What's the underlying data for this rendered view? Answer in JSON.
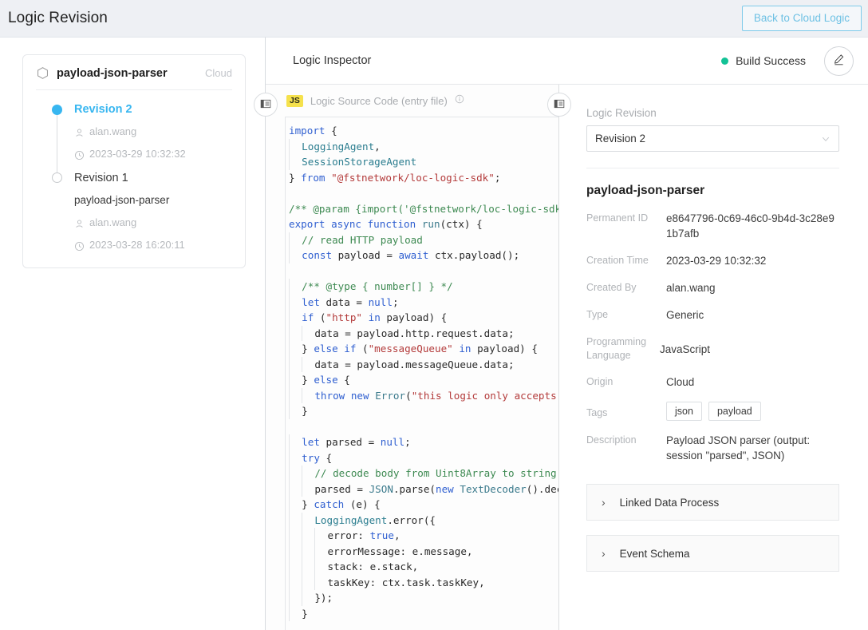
{
  "topbar": {
    "title": "Logic Revision",
    "back_button": "Back to Cloud Logic"
  },
  "sidebar": {
    "card": {
      "name": "payload-json-parser",
      "origin": "Cloud",
      "icon": "hexagon-icon"
    },
    "revisions": [
      {
        "title": "Revision 2",
        "subtitle": "",
        "author": "alan.wang",
        "timestamp": "2023-03-29 10:32:32",
        "active": true
      },
      {
        "title": "Revision 1",
        "subtitle": "payload-json-parser",
        "author": "alan.wang",
        "timestamp": "2023-03-28 16:20:11",
        "active": false
      }
    ]
  },
  "inspector": {
    "title": "Logic Inspector",
    "build_status": "Build Success",
    "build_status_color": "#13c296",
    "edit_icon": "pencil-icon"
  },
  "code_panel": {
    "badge": "JS",
    "header_label": "Logic Source Code (entry file)",
    "info_icon": "info-circle-icon",
    "collapse_icon": "panel-collapse-icon"
  },
  "detail_panel": {
    "revision_field_label": "Logic Revision",
    "revision_selected": "Revision 2",
    "logic_name": "payload-json-parser",
    "fields": [
      {
        "label": "Permanent ID",
        "value": "e8647796-0c69-46c0-9b4d-3c28e91b7afb"
      },
      {
        "label": "Creation Time",
        "value": "2023-03-29 10:32:32"
      },
      {
        "label": "Created By",
        "value": "alan.wang"
      },
      {
        "label": "Type",
        "value": "Generic"
      },
      {
        "label": "Programming Language",
        "value": "JavaScript"
      },
      {
        "label": "Origin",
        "value": "Cloud"
      }
    ],
    "tags_label": "Tags",
    "tags": [
      "json",
      "payload"
    ],
    "description_label": "Description",
    "description": "Payload JSON parser (output: session \"parsed\", JSON)",
    "accordions": [
      {
        "label": "Linked Data Process"
      },
      {
        "label": "Event Schema"
      }
    ]
  },
  "source_code": {
    "language": "javascript",
    "text": "import {\n  LoggingAgent,\n  SessionStorageAgent\n} from \"@fstnetwork/loc-logic-sdk\";\n\n/** @param {import('@fstnetwork/loc-logic-sdk\nexport async function run(ctx) {\n  // read HTTP payload\n  const payload = await ctx.payload();\n\n  /** @type { number[] } */\n  let data = null;\n  if (\"http\" in payload) {\n    data = payload.http.request.data;\n  } else if (\"messageQueue\" in payload) {\n    data = payload.messageQueue.data;\n  } else {\n    throw new Error(\"this logic only accepts\n  }\n\n  let parsed = null;\n  try {\n    // decode body from Uint8Array to string\n    parsed = JSON.parse(new TextDecoder().dec\n  } catch (e) {\n    LoggingAgent.error({\n      error: true,\n      errorMessage: e.message,\n      stack: e.stack,\n      taskKey: ctx.task.taskKey,\n    });\n  }"
  }
}
